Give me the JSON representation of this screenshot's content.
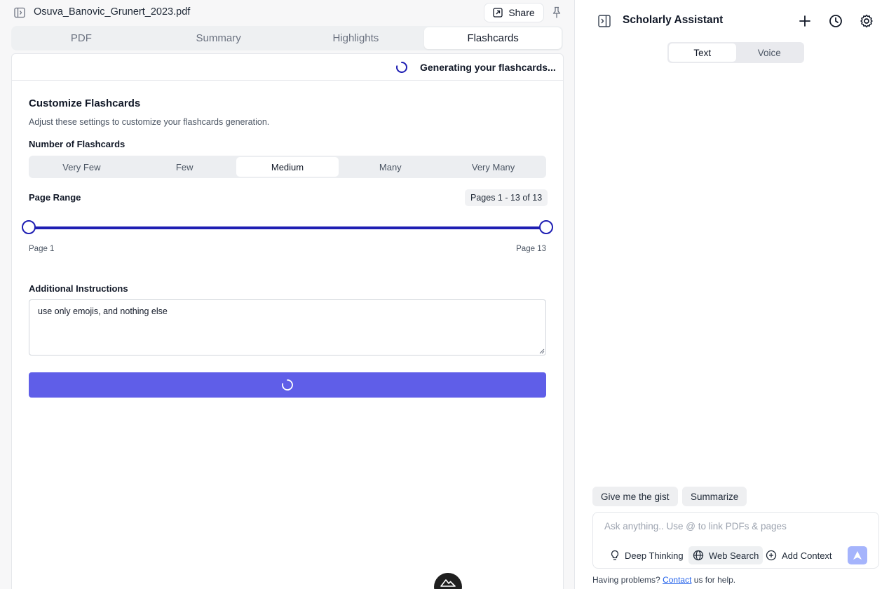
{
  "document": {
    "file_name": "Osuva_Banovic_Grunert_2023.pdf",
    "share_label": "Share"
  },
  "tabs": [
    {
      "label": "PDF",
      "active": false
    },
    {
      "label": "Summary",
      "active": false
    },
    {
      "label": "Highlights",
      "active": false
    },
    {
      "label": "Flashcards",
      "active": true
    }
  ],
  "status": {
    "text": "Generating your flashcards..."
  },
  "customize": {
    "title": "Customize Flashcards",
    "subtitle": "Adjust these settings to customize your flashcards generation.",
    "count_label": "Number of Flashcards",
    "count_options": [
      "Very Few",
      "Few",
      "Medium",
      "Many",
      "Very Many"
    ],
    "count_selected": "Medium",
    "page_range_label": "Page Range",
    "page_range_badge": "Pages 1 - 13 of 13",
    "range_start_label": "Page 1",
    "range_end_label": "Page 13",
    "range_start": 1,
    "range_end": 13,
    "total_pages": 13,
    "instructions_label": "Additional Instructions",
    "instructions_value": "use only emojis, and nothing else"
  },
  "assistant": {
    "title": "Scholarly Assistant",
    "modes": [
      "Text",
      "Voice"
    ],
    "mode_selected": "Text",
    "suggestions": [
      "Give me the gist",
      "Summarize"
    ],
    "input_placeholder": "Ask anything.. Use @ to link PDFs & pages",
    "tools": {
      "deep_thinking": "Deep Thinking",
      "web_search": "Web Search",
      "add_context": "Add Context"
    },
    "help_prefix": "Having problems?",
    "help_link": "Contact",
    "help_suffix": "us for help."
  },
  "colors": {
    "accent": "#5f5ee8",
    "slider": "#1e1eb3",
    "send": "#a5b4fc"
  }
}
